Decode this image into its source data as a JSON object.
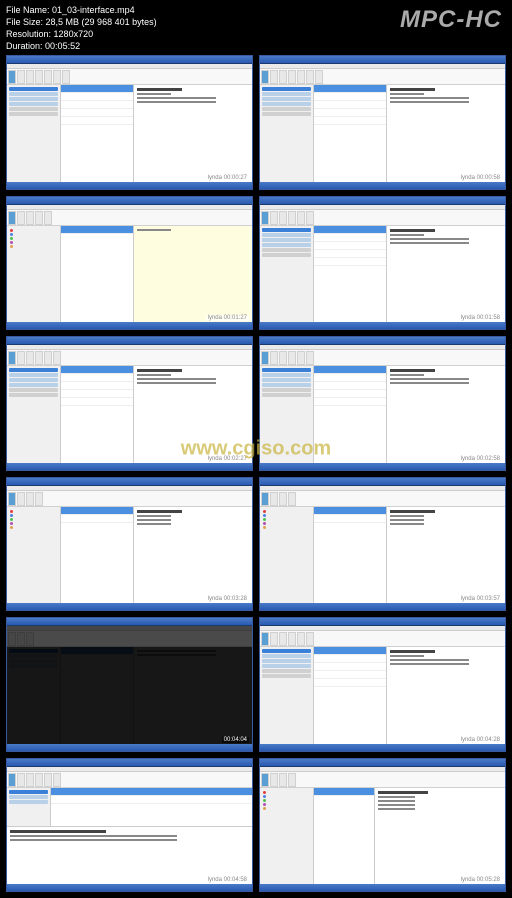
{
  "player": {
    "logo": "MPC-HC",
    "file_name_label": "File Name:",
    "file_name": "01_03-interface.mp4",
    "file_size_label": "File Size:",
    "file_size": "28,5 MB (29 968 401 bytes)",
    "resolution_label": "Resolution:",
    "resolution": "1280x720",
    "duration_label": "Duration:",
    "duration": "00:05:52"
  },
  "watermark": "www.cgiso.com",
  "thumbnails": [
    {
      "timestamp": "lynda 00:00:27",
      "subject": "Re: Staff outline meeting",
      "dark": false,
      "layout": "mail"
    },
    {
      "timestamp": "lynda 00:00:58",
      "subject": "Re: Staff outline meeting",
      "dark": false,
      "layout": "mail"
    },
    {
      "timestamp": "lynda 00:01:27",
      "subject": "",
      "dark": false,
      "layout": "calendar"
    },
    {
      "timestamp": "lynda 00:01:58",
      "subject": "Re: Staff outline meeting",
      "dark": false,
      "layout": "mail"
    },
    {
      "timestamp": "lynda 00:02:27",
      "subject": "Re: Staff outline meeting",
      "dark": false,
      "layout": "mail"
    },
    {
      "timestamp": "lynda 00:02:58",
      "subject": "Re: Staff outline meeting",
      "dark": false,
      "layout": "mail"
    },
    {
      "timestamp": "lynda 00:03:28",
      "subject": "Garrick Chow",
      "dark": false,
      "layout": "people"
    },
    {
      "timestamp": "lynda 00:03:57",
      "subject": "Garrick Chow",
      "dark": false,
      "layout": "people"
    },
    {
      "timestamp": "00:04:04",
      "subject": "",
      "dark": true,
      "layout": "mail"
    },
    {
      "timestamp": "lynda 00:04:28",
      "subject": "Re: Staff outline meeting",
      "dark": false,
      "layout": "mail"
    },
    {
      "timestamp": "lynda 00:04:58",
      "subject": "Re: Staff outline meeting",
      "dark": false,
      "layout": "mailbottom"
    },
    {
      "timestamp": "lynda 00:05:28",
      "subject": "Garrick Chow",
      "dark": false,
      "layout": "peopleedit"
    }
  ]
}
